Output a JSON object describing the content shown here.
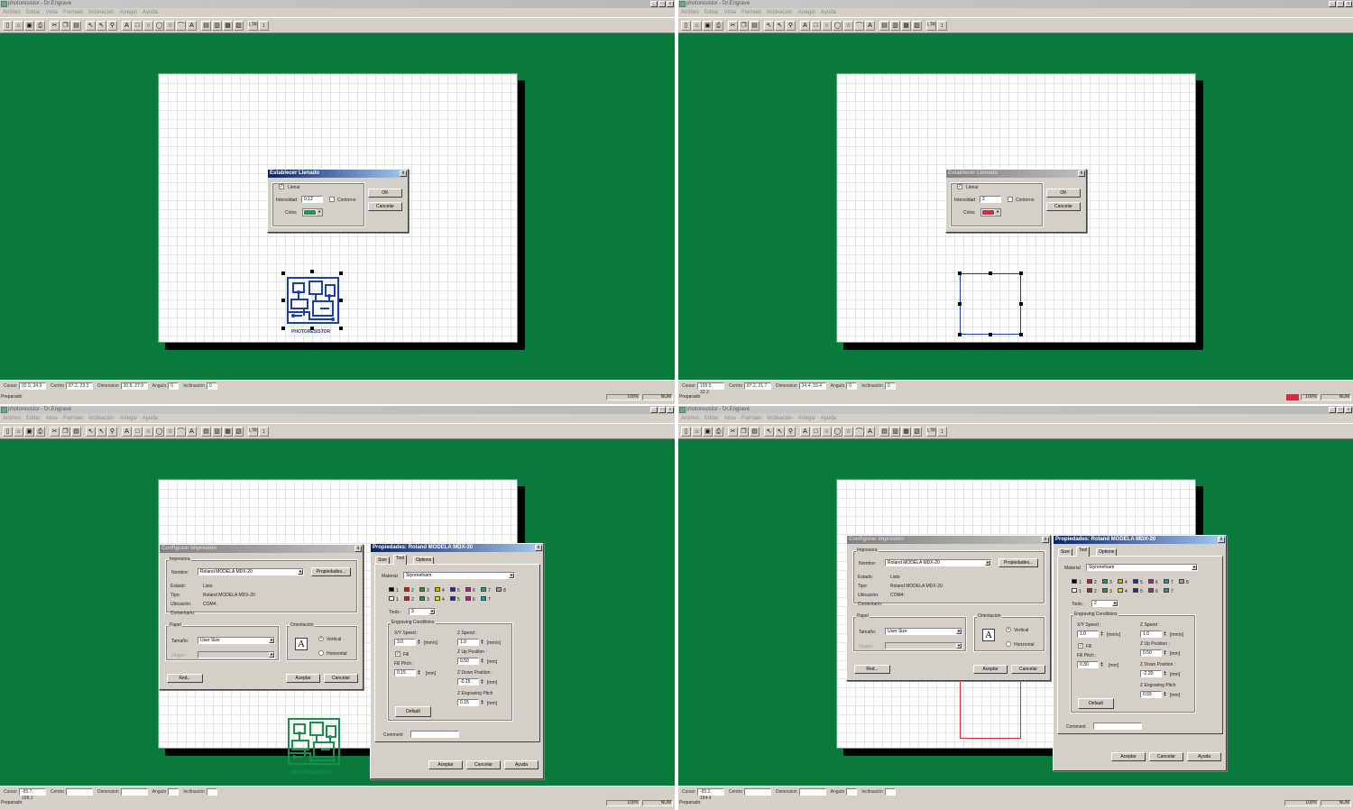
{
  "window": {
    "title": "photoresistor - Dr.Engrave",
    "min_btn": "_",
    "max_btn": "□",
    "close_btn": "x"
  },
  "menu": [
    "Archivo",
    "Editar",
    "Vista",
    "Formato",
    "Inclinación",
    "Arreglo",
    "Ayuda"
  ],
  "toolbar_icons": [
    "new-icon",
    "open-icon",
    "save-icon",
    "print-icon",
    "cut-icon",
    "copy-icon",
    "paste-icon",
    "select-arrow-icon",
    "node-edit-icon",
    "zoom-icon",
    "text-icon",
    "rectangle-icon",
    "circle-icon",
    "ellipse-icon",
    "star-icon",
    "polyline-icon",
    "image-text-icon",
    "align-icon",
    "arrange-icon",
    "layout-icon",
    "group-icon",
    "contour-icon",
    "vertical-text-icon"
  ],
  "status_labels": {
    "cursor": "Cursor",
    "center": "Centro",
    "dimension": "Dimension",
    "angle": "Angulo",
    "inclination": "Inclinación"
  },
  "bottom": {
    "ready": "Preparado",
    "zoom": "100%",
    "num": "NUM"
  },
  "panes": [
    {
      "status": {
        "cursor": "92.9, 34.9",
        "center": "87.2, 23.3",
        "dimension": "30.8, 27.9",
        "angle": "0",
        "inclination": "0"
      },
      "fill_dialog": {
        "title": "Establecer Llenado",
        "fill_label": "Llenar",
        "fill_checked": "✓",
        "intensity_label": "Intensidad",
        "intensity_value": "0.12",
        "outline_label": "Contorno",
        "color_label": "Colos",
        "color": "#1a9a4a",
        "ok": "OK",
        "cancel": "Cancelar"
      },
      "object_label": "PHOTORESISTOR"
    },
    {
      "status": {
        "cursor": "199.5, 32.3",
        "center": "87.2, 21.7",
        "dimension": "34.4, 33.4",
        "angle": "0",
        "inclination": "0"
      },
      "fill_dialog": {
        "title": "Establecer Llenado",
        "fill_label": "Llenar",
        "fill_checked": "✓",
        "intensity_label": "Intensidad",
        "intensity_value": "2",
        "outline_label": "Contorno",
        "color_label": "Colos",
        "color": "#e0263a",
        "ok": "OK",
        "cancel": "Cancelar"
      }
    },
    {
      "status": {
        "cursor": "-85.7, 188.1",
        "center": "",
        "dimension": "",
        "angle": "",
        "inclination": ""
      },
      "object_label": "PHOTORESISTOR"
    },
    {
      "status": {
        "cursor": "-85.2, 184.4",
        "center": "",
        "dimension": "",
        "angle": "",
        "inclination": ""
      }
    }
  ],
  "print_dialog": {
    "title": "Configurar impresión",
    "printer_group": "Impresora",
    "name_label": "Nombre:",
    "name_value": "Roland MODELA MDX-20",
    "properties_btn": "Propiedades...",
    "state_label": "Estado:",
    "state_value": "Listo",
    "type_label": "Tipo:",
    "type_value": "Roland MODELA MDX-20",
    "location_label": "Ubicación:",
    "location_value": "COM4:",
    "comment_label": "Comentario:",
    "paper_group": "Papel",
    "size_label": "Tamaño:",
    "size_value": "User Size",
    "origin_label": "Origen:",
    "orientation_group": "Orientación",
    "vertical": "Vertical",
    "horizontal": "Horizontal",
    "network_btn": "Red...",
    "accept": "Aceptar",
    "cancel": "Cancelar"
  },
  "props_dialog": {
    "title": "Propiedades: Roland MODELA MDX-20",
    "tabs": [
      "Size",
      "Tool",
      "Options"
    ],
    "material_label": "Material",
    "material_value": "Styrenefoam",
    "pens_row1": [
      "1",
      "2",
      "3",
      "4",
      "5",
      "6",
      "7",
      "8"
    ],
    "pens_row2": [
      "1",
      "2",
      "3",
      "4",
      "5",
      "6",
      "7"
    ],
    "pen_colors_row1": [
      "#000000",
      "#c81e1e",
      "#1e9a3a",
      "#c8b400",
      "#1e2aa8",
      "#b81e8a",
      "#1e9a9a",
      "#a0a0a0"
    ],
    "pen_colors_row2": [
      "#ffffff",
      "#c81e1e",
      "#1e9a3a",
      "#e8d800",
      "#1e2aa8",
      "#b81e8a",
      "#1e9a9a"
    ],
    "tools_label": "Tools :",
    "engraving_group": "Engraving Conditions",
    "xy_speed_label": "X/Y Speed :",
    "z_speed_label": "Z Speed :",
    "fill_label": "Fill",
    "fill_pitch_label": "Fill Pitch :",
    "z_up_label": "Z Up Position :",
    "z_down_label": "Z Down Position :",
    "z_pitch_label": "Z Engraving Pitch",
    "unit_mms": "[mm/s]",
    "unit_mm": "[mm]",
    "default_btn": "Default",
    "comment_label": "Comment",
    "accept": "Aceptar",
    "cancel": "Cancelar",
    "help": "Ayuda"
  },
  "props_values": [
    {
      "tools": "3",
      "xy_speed": "3.0",
      "z_speed": "1.0",
      "fill_pitch": "0.15",
      "z_up": "0.50",
      "z_down": "-0.15",
      "z_pitch": "0.15"
    },
    {
      "tools": "2",
      "xy_speed": "1.0",
      "z_speed": "1.0",
      "fill_pitch": "0.30",
      "z_up": "0.50",
      "z_down": "-2.20",
      "z_pitch": "0.55"
    }
  ]
}
